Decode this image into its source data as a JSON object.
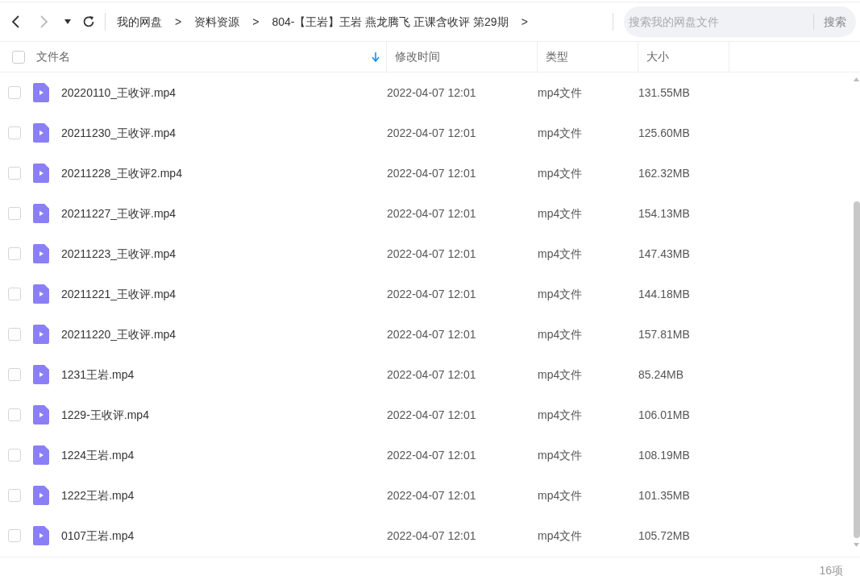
{
  "breadcrumb": [
    "我的网盘",
    "资料资源",
    "804-【王岩】王岩 燕龙腾飞 正课含收评 第29期"
  ],
  "breadcrumb_separator": ">",
  "search": {
    "placeholder": "搜索我的网盘文件",
    "button": "搜索"
  },
  "table": {
    "select_all_checked": false,
    "columns": [
      "文件名",
      "修改时间",
      "类型",
      "大小"
    ],
    "rows": [
      {
        "name": "20220110_王收评.mp4",
        "modified": "2022-04-07 12:01",
        "type": "mp4文件",
        "size": "131.55MB",
        "checked": false
      },
      {
        "name": "20211230_王收评.mp4",
        "modified": "2022-04-07 12:01",
        "type": "mp4文件",
        "size": "125.60MB",
        "checked": false
      },
      {
        "name": "20211228_王收评2.mp4",
        "modified": "2022-04-07 12:01",
        "type": "mp4文件",
        "size": "162.32MB",
        "checked": false
      },
      {
        "name": "20211227_王收评.mp4",
        "modified": "2022-04-07 12:01",
        "type": "mp4文件",
        "size": "154.13MB",
        "checked": false
      },
      {
        "name": "20211223_王收评.mp4",
        "modified": "2022-04-07 12:01",
        "type": "mp4文件",
        "size": "147.43MB",
        "checked": false
      },
      {
        "name": "20211221_王收评.mp4",
        "modified": "2022-04-07 12:01",
        "type": "mp4文件",
        "size": "144.18MB",
        "checked": false
      },
      {
        "name": "20211220_王收评.mp4",
        "modified": "2022-04-07 12:01",
        "type": "mp4文件",
        "size": "157.81MB",
        "checked": false
      },
      {
        "name": "1231王岩.mp4",
        "modified": "2022-04-07 12:01",
        "type": "mp4文件",
        "size": "85.24MB",
        "checked": false
      },
      {
        "name": "1229-王收评.mp4",
        "modified": "2022-04-07 12:01",
        "type": "mp4文件",
        "size": "106.01MB",
        "checked": false
      },
      {
        "name": "1224王岩.mp4",
        "modified": "2022-04-07 12:01",
        "type": "mp4文件",
        "size": "108.19MB",
        "checked": false
      },
      {
        "name": "1222王岩.mp4",
        "modified": "2022-04-07 12:01",
        "type": "mp4文件",
        "size": "101.35MB",
        "checked": false
      },
      {
        "name": "0107王岩.mp4",
        "modified": "2022-04-07 12:01",
        "type": "mp4文件",
        "size": "105.72MB",
        "checked": false
      }
    ]
  },
  "status_bar": {
    "count": "16项"
  }
}
